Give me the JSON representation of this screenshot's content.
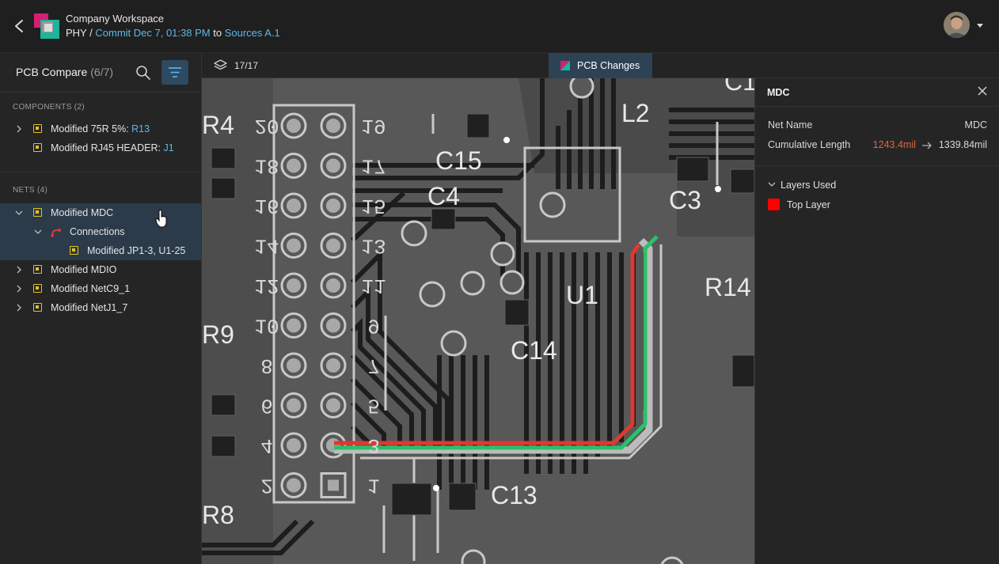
{
  "header": {
    "workspace": "Company Workspace",
    "project": "PHY",
    "separator": "/",
    "commit": "Commit Dec 7, 01:38 PM",
    "to_word": "to",
    "target": "Sources A.1"
  },
  "sidebar": {
    "title": "PCB Compare",
    "count": "(6/7)",
    "components_label": "COMPONENTS (2)",
    "components": [
      {
        "label": "Modified 75R 5%:",
        "ref": "R13"
      },
      {
        "label": "Modified RJ45 HEADER:",
        "ref": "J1"
      }
    ],
    "nets_label": "NETS (4)",
    "nets": [
      {
        "label": "Modified MDC"
      },
      {
        "label": "Connections"
      },
      {
        "label": "Modified JP1-3, U1-25"
      },
      {
        "label": "Modified MDIO"
      },
      {
        "label": "Modified NetC9_1"
      },
      {
        "label": "Modified NetJ1_7"
      }
    ]
  },
  "toolbar": {
    "layer_count": "17/17",
    "tab_label": "PCB Changes"
  },
  "pcb": {
    "pin_left": [
      "20",
      "18",
      "16",
      "14",
      "12",
      "10",
      "8",
      "6",
      "4",
      "2"
    ],
    "pin_right": [
      "19",
      "17",
      "15",
      "13",
      "11",
      "9",
      "7",
      "5",
      "3",
      "1"
    ],
    "designators": [
      "C15",
      "C4",
      "L2",
      "C3",
      "U1",
      "C14",
      "R14",
      "C13",
      "R9",
      "R8",
      "R4",
      "C1"
    ]
  },
  "panel": {
    "title": "MDC",
    "net_name_label": "Net Name",
    "net_name_value": "MDC",
    "length_label": "Cumulative Length",
    "length_old": "1243.4mil",
    "length_new": "1339.84mil",
    "layers_label": "Layers Used",
    "layers": [
      {
        "name": "Top Layer",
        "color": "#ff0000"
      }
    ]
  },
  "colors": {
    "accent": "#5bb8ea",
    "component_box": "#e3c21a",
    "trace_old": "#e0392f",
    "trace_new": "#2bc06a",
    "old_value": "#e0663a"
  }
}
